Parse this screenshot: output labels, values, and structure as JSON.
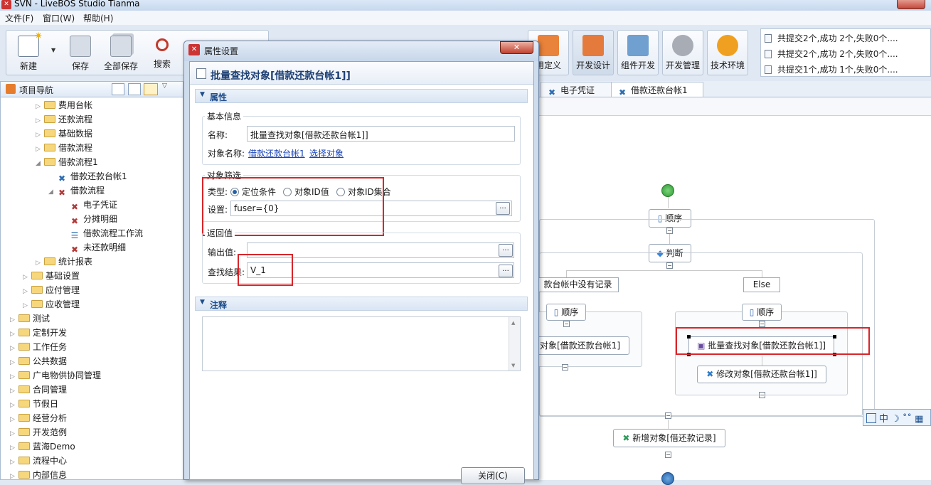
{
  "window": {
    "title": "SVN - LiveBOS Studio Tianma"
  },
  "menu": [
    "文件(F)",
    "窗口(W)",
    "帮助(H)"
  ],
  "toolbar": {
    "new": "新建",
    "save": "保存",
    "save_all": "全部保存",
    "search": "搜索"
  },
  "right_toolbar": {
    "define": "用定义",
    "dev_design": "开发设计",
    "component_dev": "组件开发",
    "dev_manage": "开发管理",
    "tech_env": "技术环境"
  },
  "status_lines": [
    "共提交2个,成功 2个,失败0个....",
    "共提交2个,成功 2个,失败0个....",
    "共提交1个,成功 1个,失败0个...."
  ],
  "nav": {
    "title": "项目导航",
    "items": [
      {
        "label": "费用台帐",
        "indent": 3,
        "icon": "folder",
        "arrow": "▷"
      },
      {
        "label": "还款流程",
        "indent": 3,
        "icon": "folder",
        "arrow": "▷"
      },
      {
        "label": "基础数据",
        "indent": 3,
        "icon": "folder",
        "arrow": "▷"
      },
      {
        "label": "借款流程",
        "indent": 3,
        "icon": "folder",
        "arrow": "▷"
      },
      {
        "label": "借款流程1",
        "indent": 3,
        "icon": "folder",
        "arrow": "◢"
      },
      {
        "label": "借款还款台帐1",
        "indent": 4,
        "icon": "object",
        "arrow": ""
      },
      {
        "label": "借款流程",
        "indent": 4,
        "icon": "flow",
        "arrow": "◢"
      },
      {
        "label": "电子凭证",
        "indent": 5,
        "icon": "flow",
        "arrow": ""
      },
      {
        "label": "分摊明细",
        "indent": 5,
        "icon": "flow",
        "arrow": ""
      },
      {
        "label": "借款流程工作流",
        "indent": 5,
        "icon": "list",
        "arrow": ""
      },
      {
        "label": "未还款明细",
        "indent": 5,
        "icon": "flow",
        "arrow": ""
      },
      {
        "label": "统计报表",
        "indent": 3,
        "icon": "folder",
        "arrow": "▷"
      },
      {
        "label": "基础设置",
        "indent": 2,
        "icon": "folder",
        "arrow": "▷"
      },
      {
        "label": "应付管理",
        "indent": 2,
        "icon": "folder",
        "arrow": "▷"
      },
      {
        "label": "应收管理",
        "indent": 2,
        "icon": "folder",
        "arrow": "▷"
      },
      {
        "label": "测试",
        "indent": 1,
        "icon": "folder",
        "arrow": "▷"
      },
      {
        "label": "定制开发",
        "indent": 1,
        "icon": "folder",
        "arrow": "▷"
      },
      {
        "label": "工作任务",
        "indent": 1,
        "icon": "folder",
        "arrow": "▷"
      },
      {
        "label": "公共数据",
        "indent": 1,
        "icon": "folder",
        "arrow": "▷"
      },
      {
        "label": "广电物供协同管理",
        "indent": 1,
        "icon": "folder",
        "arrow": "▷"
      },
      {
        "label": "合同管理",
        "indent": 1,
        "icon": "folder",
        "arrow": "▷"
      },
      {
        "label": "节假日",
        "indent": 1,
        "icon": "folder",
        "arrow": "▷"
      },
      {
        "label": "经营分析",
        "indent": 1,
        "icon": "folder",
        "arrow": "▷"
      },
      {
        "label": "开发范例",
        "indent": 1,
        "icon": "folder",
        "arrow": "▷"
      },
      {
        "label": "蓝海Demo",
        "indent": 1,
        "icon": "folder",
        "arrow": "▷"
      },
      {
        "label": "流程中心",
        "indent": 1,
        "icon": "folder",
        "arrow": "▷"
      },
      {
        "label": "内部信息",
        "indent": 1,
        "icon": "folder",
        "arrow": "▷"
      }
    ]
  },
  "editor_tabs": [
    "电子凭证",
    "借款还款台帐1"
  ],
  "flow": {
    "sequence": "顺序",
    "judge": "判断",
    "branch_left": "款台帐中没有记录",
    "branch_else": "Else",
    "left_object": "对象[借款还款台帐1]",
    "batch_find": "批量查找对象[借款还款台帐1]]",
    "modify": "修改对象[借款还款台帐1]]",
    "add": "新增对象[借还款记录]"
  },
  "dialog": {
    "title": "属性设置",
    "heading": "批量查找对象[借款还款台帐1]]",
    "section_props": "属性",
    "basic_info": "基本信息",
    "name_label": "名称:",
    "name_value": "批量查找对象[借款还款台帐1]]",
    "object_name_label": "对象名称:",
    "object_name_link": "借款还款台帐1",
    "select_object_link": "选择对象",
    "filter_title": "对象筛选",
    "type_label": "类型:",
    "type_options": [
      "定位条件",
      "对象ID值",
      "对象ID集合"
    ],
    "type_selected": "定位条件",
    "setting_label": "设置:",
    "setting_value": "fuser={0}",
    "return_title": "返回值",
    "output_label": "输出值:",
    "output_value": "",
    "result_label": "查找结果:",
    "result_value": "V_1",
    "section_notes": "注释",
    "close_button": "关闭(C)"
  },
  "ime": {
    "label": "中"
  }
}
